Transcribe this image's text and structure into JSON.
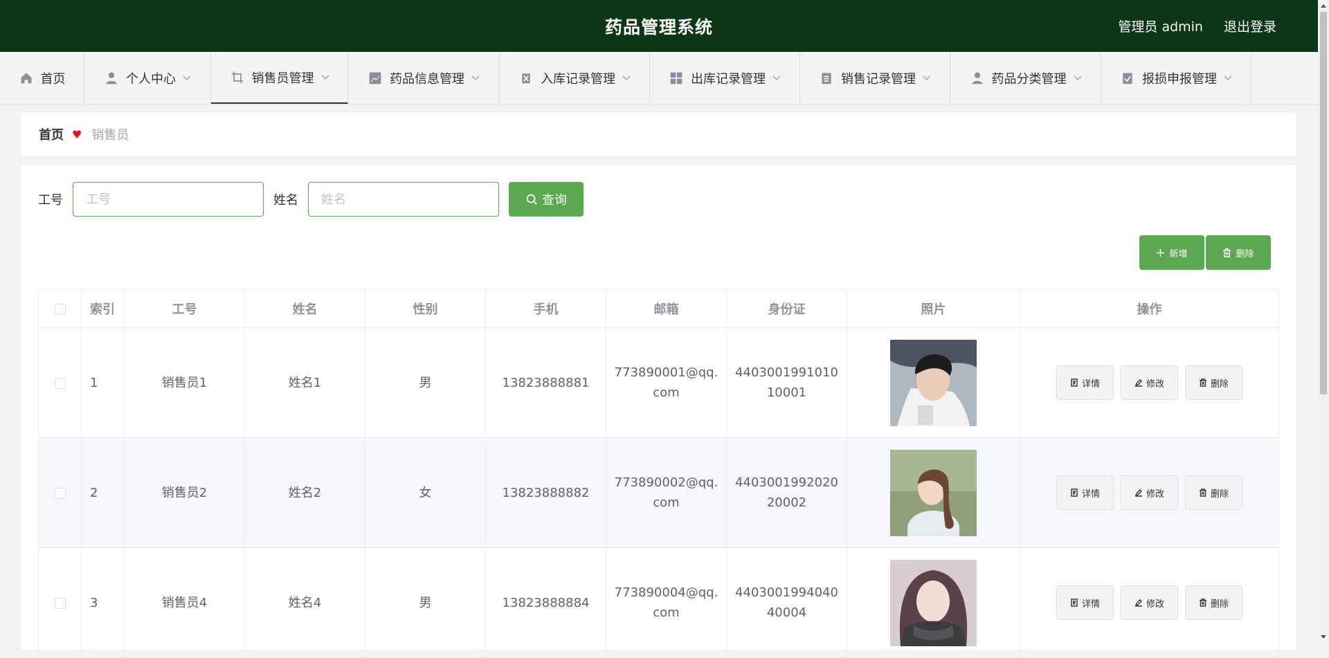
{
  "app": {
    "title": "药品管理系统",
    "user_label": "管理员 admin",
    "logout_label": "退出登录"
  },
  "nav": [
    {
      "label": "首页",
      "icon": "home-icon",
      "dropdown": false,
      "active": false
    },
    {
      "label": "个人中心",
      "icon": "user-icon",
      "dropdown": true,
      "active": false
    },
    {
      "label": "销售员管理",
      "icon": "crop-icon",
      "dropdown": true,
      "active": true
    },
    {
      "label": "药品信息管理",
      "icon": "chart-icon",
      "dropdown": true,
      "active": false
    },
    {
      "label": "入库记录管理",
      "icon": "clipboard-x-icon",
      "dropdown": true,
      "active": false
    },
    {
      "label": "出库记录管理",
      "icon": "grid-icon",
      "dropdown": true,
      "active": false
    },
    {
      "label": "销售记录管理",
      "icon": "clipboard-icon",
      "dropdown": true,
      "active": false
    },
    {
      "label": "药品分类管理",
      "icon": "user-icon",
      "dropdown": true,
      "active": false
    },
    {
      "label": "报损申报管理",
      "icon": "clipboard-check-icon",
      "dropdown": true,
      "active": false
    }
  ],
  "breadcrumb": {
    "home": "首页",
    "current": "销售员"
  },
  "search": {
    "field1_label": "工号",
    "field1_placeholder": "工号",
    "field1_value": "",
    "field2_label": "姓名",
    "field2_placeholder": "姓名",
    "field2_value": "",
    "query_label": "查询"
  },
  "actions": {
    "add_label": "新增",
    "delete_label": "删除"
  },
  "table": {
    "headers": [
      "索引",
      "工号",
      "姓名",
      "性别",
      "手机",
      "邮箱",
      "身份证",
      "照片",
      "操作"
    ],
    "rows": [
      {
        "index": "1",
        "id": "销售员1",
        "name": "姓名1",
        "gender": "男",
        "phone": "13823888881",
        "email": "773890001@qq.com",
        "idcard": "440300199101010001",
        "photo": "photo-young-man"
      },
      {
        "index": "2",
        "id": "销售员2",
        "name": "姓名2",
        "gender": "女",
        "phone": "13823888882",
        "email": "773890002@qq.com",
        "idcard": "440300199202020002",
        "photo": "photo-girl-ponytail"
      },
      {
        "index": "3",
        "id": "销售员4",
        "name": "姓名4",
        "gender": "男",
        "phone": "13823888884",
        "email": "773890004@qq.com",
        "idcard": "440300199404040004",
        "photo": "photo-girl-scarf"
      }
    ],
    "row_actions": {
      "detail": "详情",
      "edit": "修改",
      "delete": "删除"
    }
  },
  "colors": {
    "topbar": "#0d3617",
    "accent": "#5aa84f",
    "heart": "#e81123"
  }
}
